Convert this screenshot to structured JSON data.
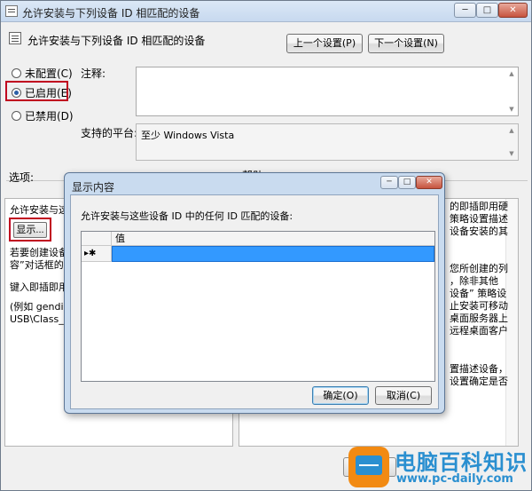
{
  "window": {
    "title": "允许安装与下列设备 ID 相匹配的设备",
    "controls": {
      "minimize": "─",
      "maximize": "□",
      "close": "✕"
    }
  },
  "header": {
    "title": "允许安装与下列设备 ID 相匹配的设备",
    "prev_button": "上一个设置(P)",
    "next_button": "下一个设置(N)"
  },
  "state": {
    "options": [
      {
        "label": "未配置(C)",
        "selected": false
      },
      {
        "label": "已启用(E)",
        "selected": true
      },
      {
        "label": "已禁用(D)",
        "selected": false
      }
    ]
  },
  "comment": {
    "label": "注释:",
    "value": ""
  },
  "platform": {
    "label": "支持的平台:",
    "value": "至少 Windows Vista"
  },
  "options_panel": {
    "label": "选项:",
    "lines": [
      "允许安装与这",
      "若要创建设备",
      "容”对话框的",
      "键入即插即用",
      "(例如 gendis",
      "USB\\Class_ff"
    ],
    "show_button": "显示..."
  },
  "help_panel": {
    "label": "帮助:",
    "lines": [
      "的即插即用硬",
      "策略设置描述",
      "设备安装的其",
      "您所创建的列",
      "，除非其他",
      "设备” 策略设",
      "止安装可移动",
      "桌面服务器上",
      "远程桌面客户",
      "置描述设备，",
      "设置确定是否"
    ]
  },
  "dialog": {
    "title": "显示内容",
    "controls": {
      "minimize": "─",
      "maximize": "□",
      "close": "✕"
    },
    "prompt": "允许安装与这些设备 ID 中的任何 ID 匹配的设备:",
    "column_header": "值",
    "new_row_marker": "▸✱",
    "ok_button": "确定(O)",
    "cancel_button": "取消(C)"
  },
  "watermark": {
    "brand": "电脑百科知识",
    "url": "www.pc-daily.com"
  },
  "colors": {
    "highlight": "#c0001f",
    "selection": "#3399ff",
    "brand": "#2a8fd0",
    "brand_accent": "#f28a12"
  }
}
